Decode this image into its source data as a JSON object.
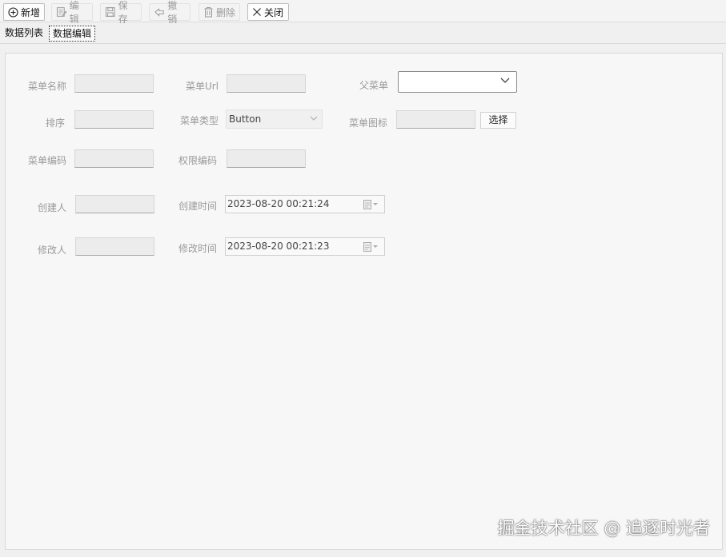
{
  "toolbar": {
    "new_label": "新增",
    "edit_label": "编辑",
    "save_label": "保存",
    "undo_label": "撤销",
    "delete_label": "删除",
    "close_label": "关闭"
  },
  "tabs": [
    {
      "label": "数据列表"
    },
    {
      "label": "数据编辑"
    }
  ],
  "form": {
    "menu_name_label": "菜单名称",
    "menu_url_label": "菜单Url",
    "parent_menu_label": "父菜单",
    "sort_label": "排序",
    "menu_type_label": "菜单类型",
    "menu_type_value": "Button",
    "menu_icon_label": "菜单图标",
    "select_button_label": "选择",
    "menu_code_label": "菜单编码",
    "permission_code_label": "权限编码",
    "creator_label": "创建人",
    "create_time_label": "创建时间",
    "create_time_value": "2023-08-20 00:21:24",
    "modifier_label": "修改人",
    "modify_time_label": "修改时间",
    "modify_time_value": "2023-08-20 00:21:23"
  },
  "watermark": "掘金技术社区 @ 追逐时光者"
}
